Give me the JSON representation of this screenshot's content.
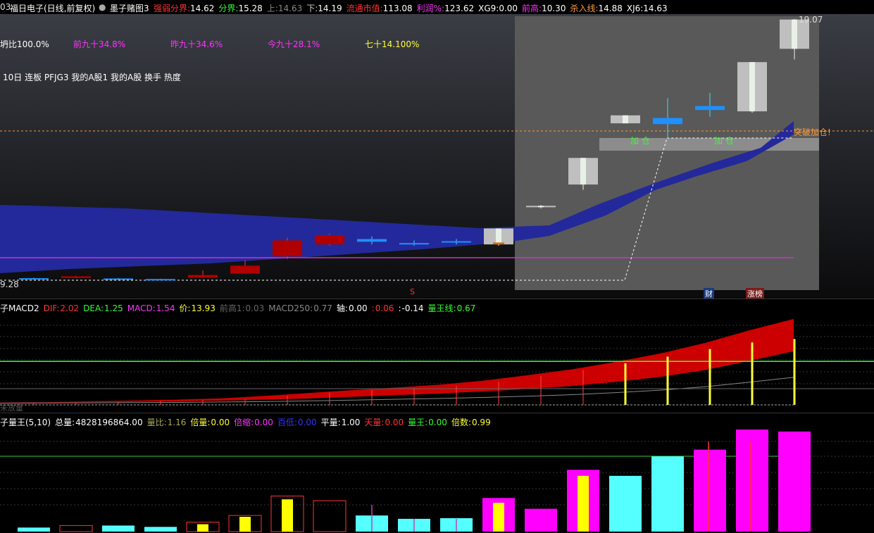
{
  "topbar": {
    "code_tail": "03",
    "stock_name": "福日电子(日线,前复权)",
    "formula_name": "墨子赌图3",
    "items": [
      {
        "label": "强弱分界:",
        "value": "14.62",
        "color": "#ff3333"
      },
      {
        "label": "分界:",
        "value": "15.28",
        "color": "#33ff33"
      },
      {
        "label": "上:",
        "value": "14.63",
        "color": "#888888"
      },
      {
        "label": "下:",
        "value": "14.19",
        "color": "#cccccc"
      },
      {
        "label": "流通市值:",
        "value": "113.08",
        "color": "#ff3333"
      },
      {
        "label": "利润%:",
        "value": "123.62",
        "color": "#ff33ff"
      },
      {
        "label": "XG9:",
        "value": "0.00",
        "color": "#ffffff"
      },
      {
        "label": "前高:",
        "value": "10.30",
        "color": "#ff33ff"
      },
      {
        "label": "杀入线:",
        "value": "14.88",
        "color": "#ff9933"
      },
      {
        "label": "XJ6:",
        "value": "14.63",
        "color": "#ffffff"
      }
    ]
  },
  "stats_row": [
    {
      "text": "坍比100.0%",
      "color": "#ffffff"
    },
    {
      "text": "前九十34.8%",
      "color": "#ff33ff"
    },
    {
      "text": "昨九十34.6%",
      "color": "#ff33ff"
    },
    {
      "text": "今九十28.1%",
      "color": "#ff33ff"
    },
    {
      "text": "七十14.100%",
      "color": "#ffff33"
    }
  ],
  "tags_row": "10日 连板 PFJG3 我的A股1 我的A股 换手 热度",
  "annotations": {
    "max_price": "19.07",
    "min_price": "9.28",
    "breakout": "突破加仓!",
    "add1": "加 仓",
    "add2": "加 仓",
    "marker_s": "S",
    "tag_cai": "财",
    "tag_zhangbang": "涨榜"
  },
  "macd_header": {
    "title": "子MACD2",
    "items": [
      {
        "label": "DIF:",
        "value": "2.02",
        "color": "#ff3333"
      },
      {
        "label": "DEA:",
        "value": "1.25",
        "color": "#33ff33"
      },
      {
        "label": "MACD:",
        "value": "1.54",
        "color": "#ff33ff"
      },
      {
        "label": "价:",
        "value": "13.93",
        "color": "#ffff33"
      },
      {
        "label": "前高1:",
        "value": "0.03",
        "color": "#666666"
      },
      {
        "label": "MACD250:",
        "value": "0.77",
        "color": "#888888"
      },
      {
        "label": "轴:",
        "value": "0.00",
        "color": "#ffffff"
      },
      {
        "label": ":",
        "value": "0.06",
        "color": "#ff3333"
      },
      {
        "label": ":",
        "value": "-0.14",
        "color": "#ffffff"
      },
      {
        "label": "量王线:",
        "value": "0.67",
        "color": "#33ff33"
      }
    ],
    "bottom_label": "未放量"
  },
  "vol_header": {
    "title": "子量王(5,10)",
    "items": [
      {
        "label": "总量:",
        "value": "4828196864.00",
        "color": "#ffffff"
      },
      {
        "label": "量比:",
        "value": "1.16",
        "color": "#aaaa55"
      },
      {
        "label": "倍量:",
        "value": "0.00",
        "color": "#ffff33"
      },
      {
        "label": "倍缩:",
        "value": "0.00",
        "color": "#ff33ff"
      },
      {
        "label": "百低:",
        "value": "0.00",
        "color": "#3333ff"
      },
      {
        "label": "平量:",
        "value": "1.00",
        "color": "#ffffff"
      },
      {
        "label": "天量:",
        "value": "0.00",
        "color": "#ff3333"
      },
      {
        "label": "量王:",
        "value": "0.00",
        "color": "#33ff33"
      },
      {
        "label": "倍数:",
        "value": "0.99",
        "color": "#ffff33"
      }
    ]
  },
  "chart_data": [
    {
      "type": "candlestick",
      "title": "福日电子(日线,前复权)",
      "max_label": 19.07,
      "min_label": 9.28,
      "candles": [
        {
          "o": 9.33,
          "c": 9.3,
          "h": 9.35,
          "l": 9.28,
          "kind": "cyan"
        },
        {
          "o": 9.34,
          "c": 9.4,
          "h": 9.42,
          "l": 9.33,
          "kind": "red"
        },
        {
          "o": 9.32,
          "c": 9.3,
          "h": 9.34,
          "l": 9.28,
          "kind": "cyan"
        },
        {
          "o": 9.3,
          "c": 9.26,
          "h": 9.31,
          "l": 9.25,
          "kind": "cyan"
        },
        {
          "o": 9.35,
          "c": 9.45,
          "h": 9.62,
          "l": 9.34,
          "kind": "red"
        },
        {
          "o": 9.5,
          "c": 9.8,
          "h": 10.0,
          "l": 9.5,
          "kind": "red"
        },
        {
          "o": 10.15,
          "c": 10.75,
          "h": 10.85,
          "l": 10.05,
          "kind": "red"
        },
        {
          "o": 10.6,
          "c": 10.95,
          "h": 11.0,
          "l": 10.55,
          "kind": "red"
        },
        {
          "o": 10.7,
          "c": 10.8,
          "h": 10.9,
          "l": 10.6,
          "kind": "cyan"
        },
        {
          "o": 10.63,
          "c": 10.65,
          "h": 10.75,
          "l": 10.55,
          "kind": "cyan"
        },
        {
          "o": 10.68,
          "c": 10.72,
          "h": 10.8,
          "l": 10.6,
          "kind": "cyan"
        },
        {
          "o": 10.6,
          "c": 11.2,
          "h": 11.2,
          "l": 10.55,
          "kind": "grey"
        },
        {
          "o": 12.0,
          "c": 12.05,
          "h": 12.08,
          "l": 11.95,
          "kind": "grey"
        },
        {
          "o": 12.85,
          "c": 13.85,
          "h": 13.85,
          "l": 12.65,
          "kind": "grey"
        },
        {
          "o": 15.15,
          "c": 15.45,
          "h": 15.45,
          "l": 15.15,
          "kind": "grey"
        },
        {
          "o": 15.12,
          "c": 15.35,
          "h": 16.1,
          "l": 14.6,
          "kind": "cyan"
        },
        {
          "o": 15.65,
          "c": 15.8,
          "h": 16.3,
          "l": 15.4,
          "kind": "cyan"
        },
        {
          "o": 15.6,
          "c": 17.45,
          "h": 17.45,
          "l": 15.55,
          "kind": "grey"
        },
        {
          "o": 17.95,
          "c": 19.05,
          "h": 19.07,
          "l": 17.55,
          "kind": "grey"
        }
      ]
    },
    {
      "type": "area",
      "title": "子MACD2",
      "series": [
        {
          "name": "DIF",
          "values": [
            0.02,
            0.03,
            0.05,
            0.07,
            0.09,
            0.12,
            0.18,
            0.25,
            0.32,
            0.38,
            0.45,
            0.55,
            0.68,
            0.82,
            1.0,
            1.2,
            1.45,
            1.75,
            2.02
          ]
        },
        {
          "name": "DEA",
          "values": [
            0.01,
            0.02,
            0.03,
            0.04,
            0.05,
            0.07,
            0.09,
            0.12,
            0.16,
            0.2,
            0.24,
            0.29,
            0.35,
            0.42,
            0.52,
            0.64,
            0.8,
            1.02,
            1.25
          ]
        },
        {
          "name": "MACD",
          "values": [
            0.02,
            0.02,
            0.04,
            0.06,
            0.08,
            0.1,
            0.18,
            0.26,
            0.32,
            0.36,
            0.42,
            0.52,
            0.66,
            0.8,
            0.96,
            1.12,
            1.3,
            1.46,
            1.54
          ]
        }
      ],
      "reference_lines": [
        {
          "name": "量王线",
          "value": 0.67
        }
      ]
    },
    {
      "type": "bar",
      "title": "子量王(5,10)",
      "values": [
        0.06,
        0.09,
        0.09,
        0.07,
        0.14,
        0.24,
        0.53,
        0.46,
        0.24,
        0.19,
        0.2,
        0.5,
        0.34,
        0.92,
        0.83,
        1.12,
        1.22,
        1.52,
        1.49
      ],
      "inner": [
        0.0,
        0.0,
        0.0,
        0.0,
        0.11,
        0.22,
        0.48,
        0.0,
        0.0,
        0.0,
        0.0,
        0.43,
        0.0,
        0.83,
        0.0,
        0.0,
        0.0,
        0.0,
        0.0
      ]
    }
  ]
}
